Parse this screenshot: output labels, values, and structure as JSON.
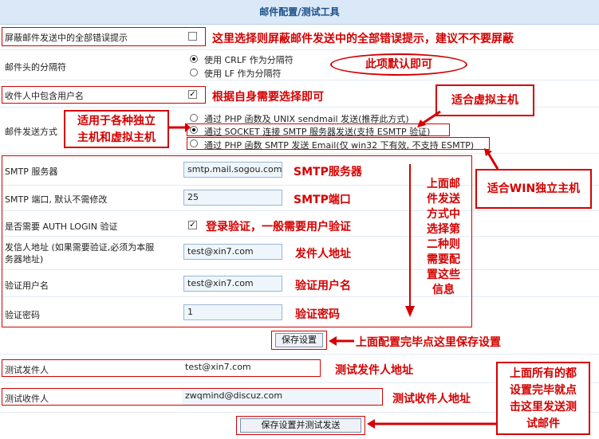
{
  "header": {
    "title": "邮件配置/测试工具"
  },
  "rows": {
    "silent_errors": {
      "label": "屏蔽邮件发送中的全部错误提示",
      "checked": false
    },
    "header_separator": {
      "label": "邮件头的分隔符",
      "options": [
        "使用 CRLF 作为分隔符",
        "使用 LF 作为分隔符"
      ],
      "selected": 0
    },
    "include_username": {
      "label": "收件人中包含用户名",
      "checked": true
    },
    "send_method": {
      "label": "邮件发送方式",
      "options": [
        "通过 PHP 函数及 UNIX sendmail 发送(推荐此方式)",
        "通过 SOCKET 连接 SMTP 服务器发送(支持 ESMTP 验证)",
        "通过 PHP 函数 SMTP 发送 Email(仅 win32 下有效, 不支持 ESMTP)"
      ],
      "selected": 1
    },
    "smtp_server": {
      "label": "SMTP 服务器",
      "value": "smtp.mail.sogou.com"
    },
    "smtp_port": {
      "label": "SMTP 端口, 默认不需修改",
      "value": "25"
    },
    "auth_login": {
      "label": "是否需要 AUTH LOGIN 验证",
      "checked": true
    },
    "from_address": {
      "label_line1": "发信人地址 (如果需要验证,必须为本服",
      "label_line2": "务器地址)",
      "value": "test@xin7.com"
    },
    "auth_user": {
      "label": "验证用户名",
      "value": "test@xin7.com"
    },
    "auth_password": {
      "label": "验证密码",
      "value": "1"
    },
    "test_sender": {
      "label": "测试发件人",
      "value": "test@xin7.com"
    },
    "test_recipient": {
      "label": "测试收件人",
      "value": "zwqmind@discuz.com"
    }
  },
  "buttons": {
    "save": "保存设置",
    "save_and_test": "保存设置并测试发送"
  },
  "annotations": {
    "silent_errors_note": "这里选择则屏蔽邮件发送中的全部错误提示，建议不不要屏蔽",
    "default_note": "此项默认即可",
    "username_note": "根据自身需要选择即可",
    "virtual_host_line1": "适用于各种独立",
    "virtual_host_line2": "主机和虚拟主机",
    "virtual_note": "适合虚拟主机",
    "win_note": "适合WIN独立主机",
    "smtp_server_note": "SMTP服务器",
    "smtp_port_note": "SMTP端口",
    "auth_note": "登录验证，一般需要用户验证",
    "from_note": "发件人地址",
    "user_note": "验证用户名",
    "password_note": "验证密码",
    "vertical_note": [
      "上面邮",
      "件发送",
      "方式中",
      "选择第",
      "二种则",
      "需要配",
      "置这些",
      "信息"
    ],
    "save_note": "上面配置完毕点这里保存设置",
    "test_sender_note": "测试发件人地址",
    "test_recipient_note": "测试收件人地址",
    "final_note": [
      "上面所有的都",
      "设置完毕就点",
      "击这里发送测",
      "试邮件"
    ]
  },
  "colors": {
    "annotation_red": "#d40000",
    "header_bg": "#dbe8f7",
    "input_bg": "#eef6fb"
  }
}
